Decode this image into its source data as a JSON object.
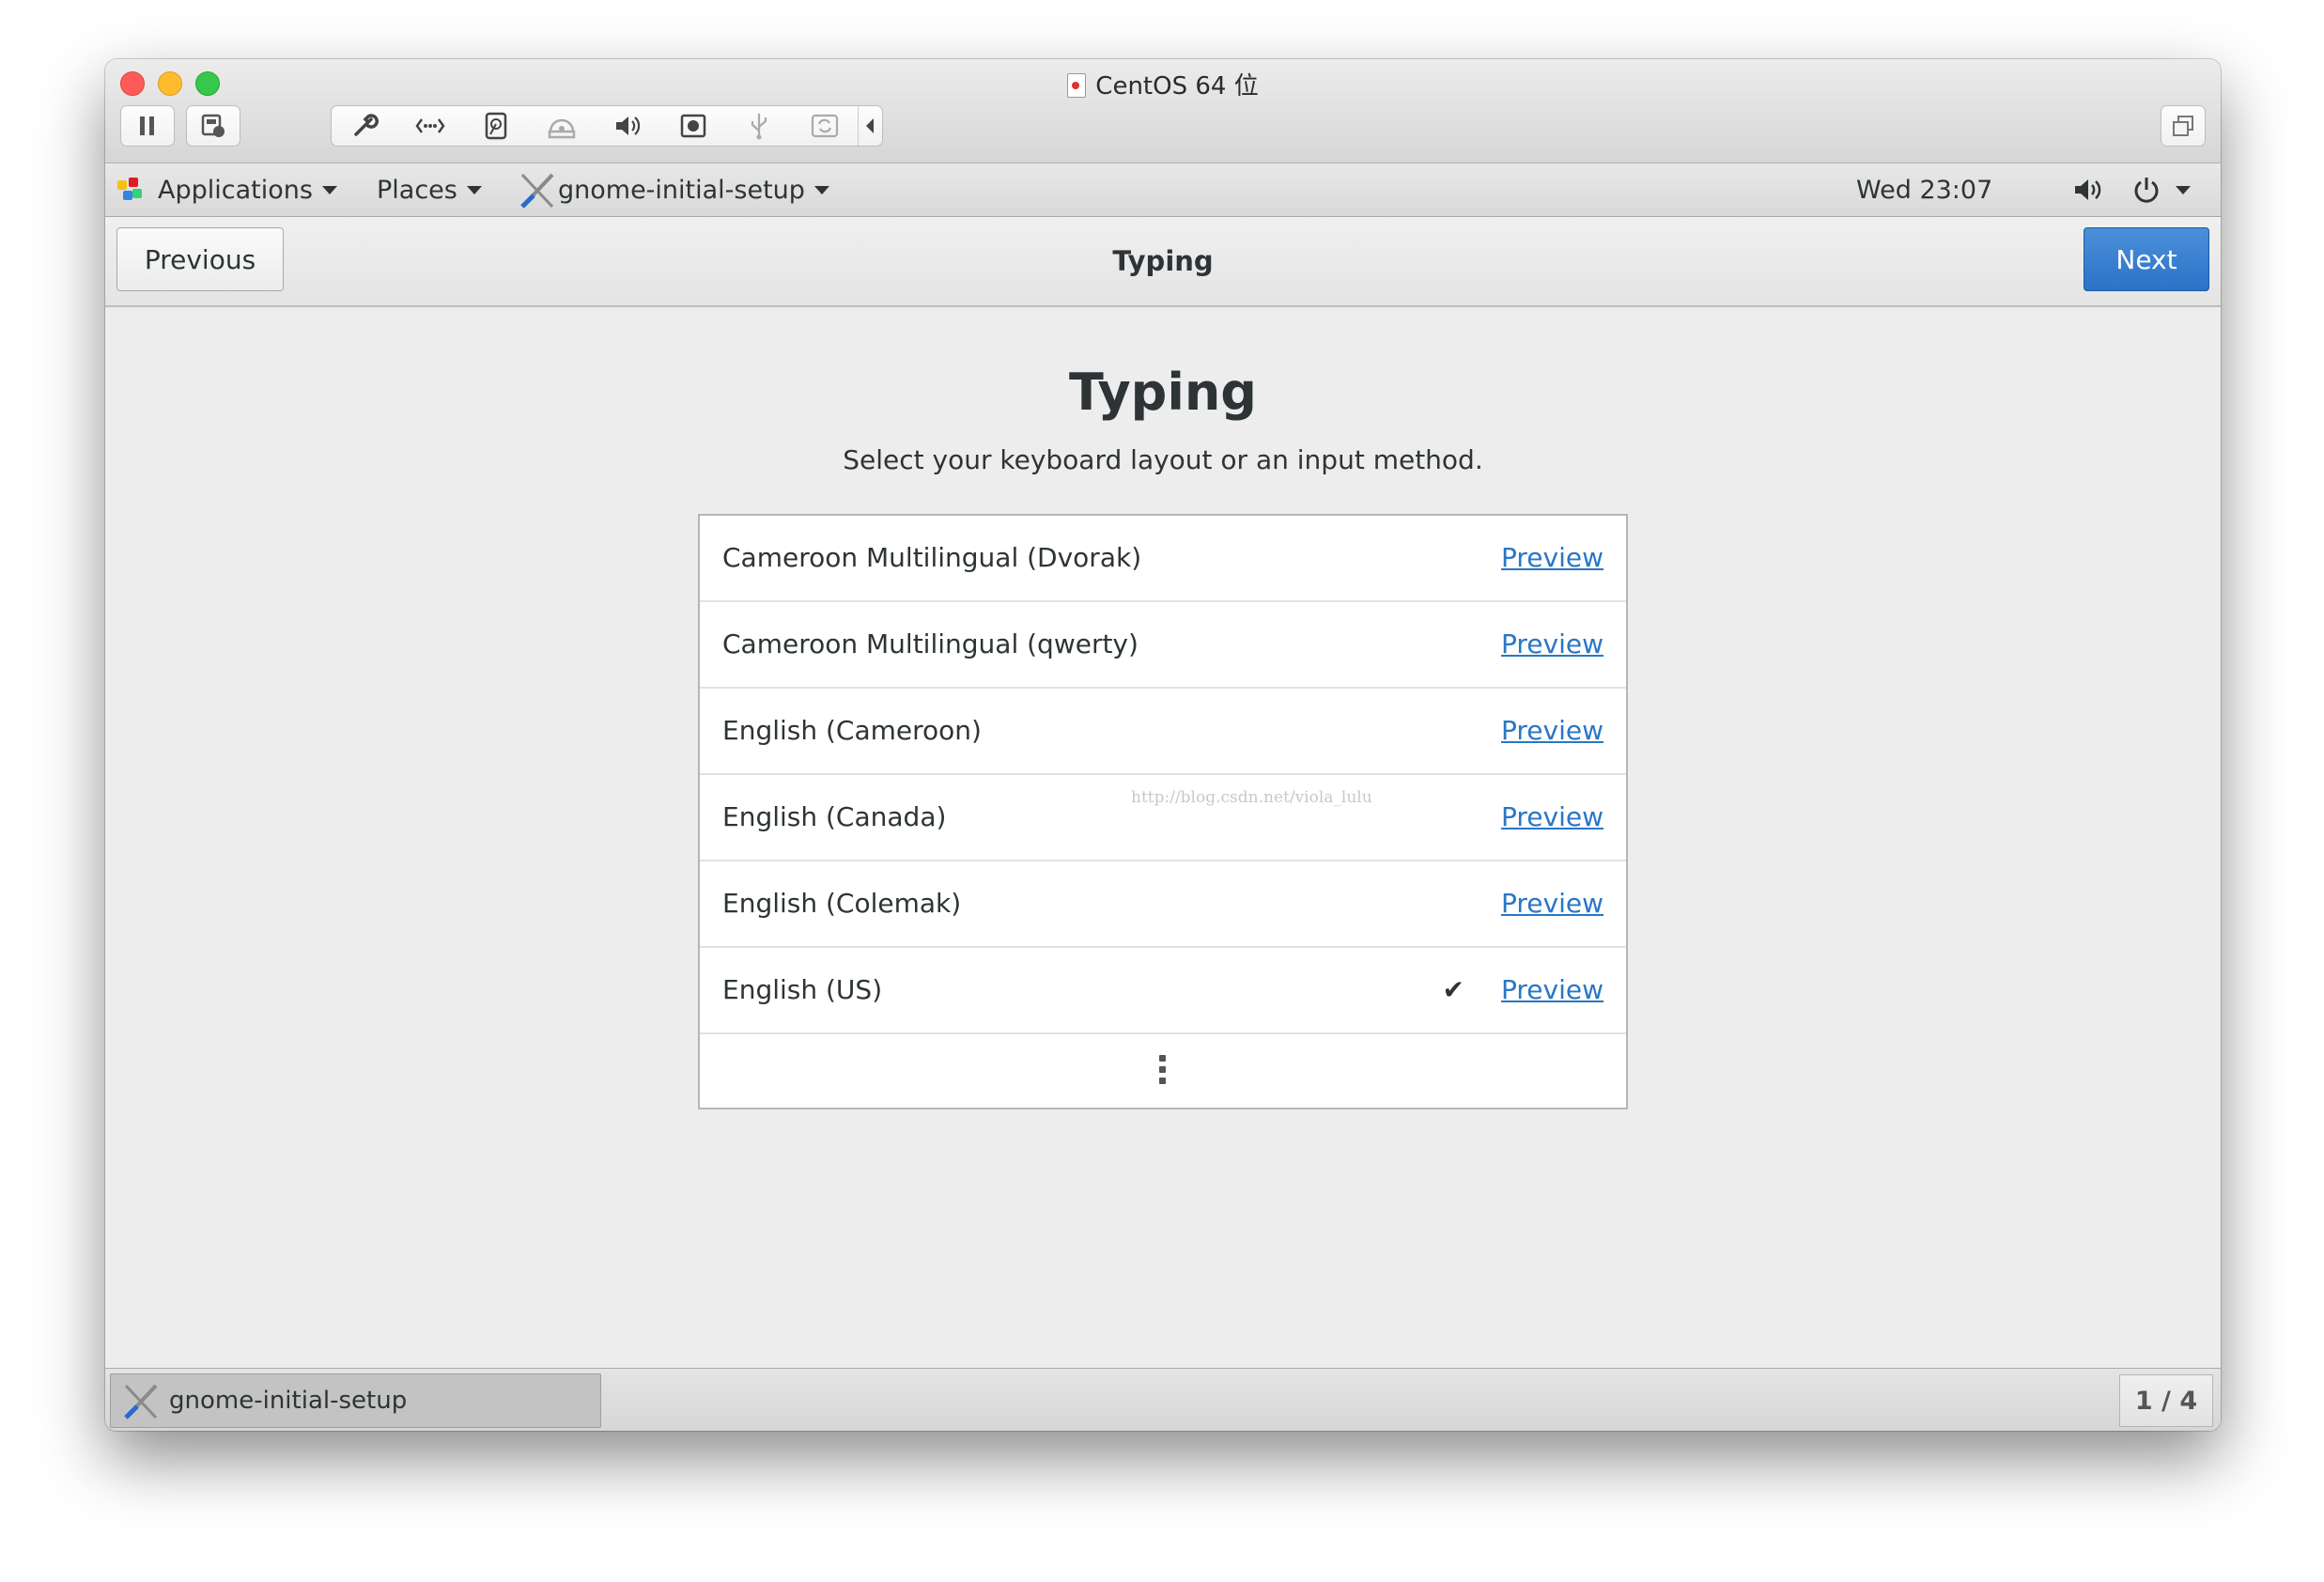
{
  "window": {
    "title": "CentOS 64 位"
  },
  "toolbar": {
    "icons": [
      "pause-icon",
      "snapshot-icon",
      "wrench-icon",
      "network-icon",
      "hard-disk-icon",
      "cd-drive-icon",
      "speaker-icon",
      "camera-icon",
      "usb-icon",
      "sync-icon",
      "caret-left-icon",
      "fullscreen-icon"
    ]
  },
  "topbar": {
    "applications": "Applications",
    "places": "Places",
    "app_name": "gnome-initial-setup",
    "clock": "Wed 23:07"
  },
  "header": {
    "previous": "Previous",
    "title": "Typing",
    "next": "Next",
    "accent": "#3584e4"
  },
  "main": {
    "title": "Typing",
    "subtitle": "Select your keyboard layout or an input method.",
    "layouts": [
      {
        "name": "Cameroon Multilingual (Dvorak)",
        "preview": "Preview",
        "selected": false
      },
      {
        "name": "Cameroon Multilingual (qwerty)",
        "preview": "Preview",
        "selected": false
      },
      {
        "name": "English (Cameroon)",
        "preview": "Preview",
        "selected": false
      },
      {
        "name": "English (Canada)",
        "preview": "Preview",
        "selected": false
      },
      {
        "name": "English (Colemak)",
        "preview": "Preview",
        "selected": false
      },
      {
        "name": "English (US)",
        "preview": "Preview",
        "selected": true
      }
    ],
    "check_mark": "✔",
    "watermark": "http://blog.csdn.net/viola_lulu"
  },
  "taskbar": {
    "task_label": "gnome-initial-setup",
    "workspace": "1 / 4"
  }
}
